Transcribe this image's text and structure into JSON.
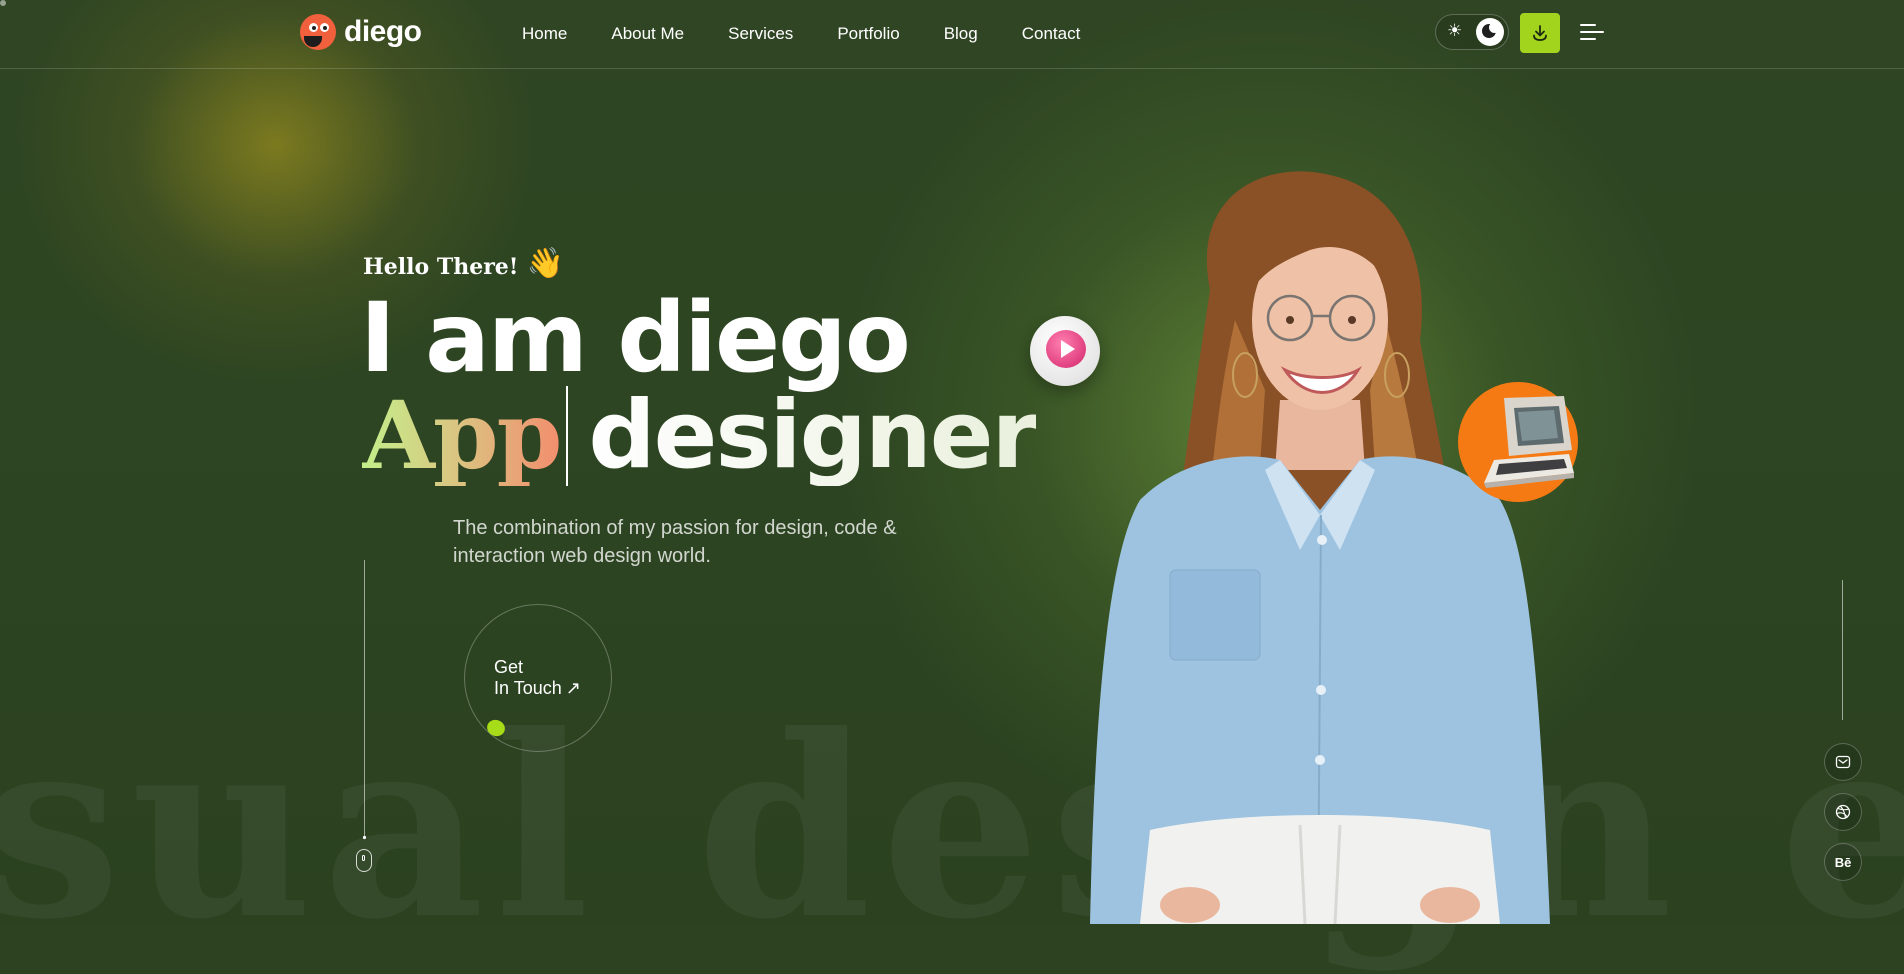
{
  "brand": {
    "name": "diego",
    "accent": "#a2d41e",
    "logo_color": "#f0603c"
  },
  "nav": {
    "items": [
      {
        "label": "Home"
      },
      {
        "label": "About Me"
      },
      {
        "label": "Services"
      },
      {
        "label": "Portfolio"
      },
      {
        "label": "Blog"
      },
      {
        "label": "Contact"
      }
    ]
  },
  "header": {
    "theme_toggle": {
      "sun_icon": "sun-icon",
      "moon_icon": "moon-icon",
      "mode": "dark"
    },
    "download_icon": "download-icon",
    "menu_icon": "hamburger-menu-icon"
  },
  "hero": {
    "greeting": "Hello There!",
    "greeting_emoji": "👋",
    "headline": "I am diego",
    "role_highlight": "App",
    "role_rest": "designer",
    "description": "The combination of my passion for design, code & interaction web design world.",
    "cta_line1": "Get",
    "cta_line2": "In Touch",
    "cta_arrow": "↗",
    "watermark": "sual design er Vi"
  },
  "social": [
    {
      "name": "mail-icon"
    },
    {
      "name": "dribbble-icon"
    },
    {
      "name": "behance-icon",
      "text": "Bē"
    }
  ]
}
